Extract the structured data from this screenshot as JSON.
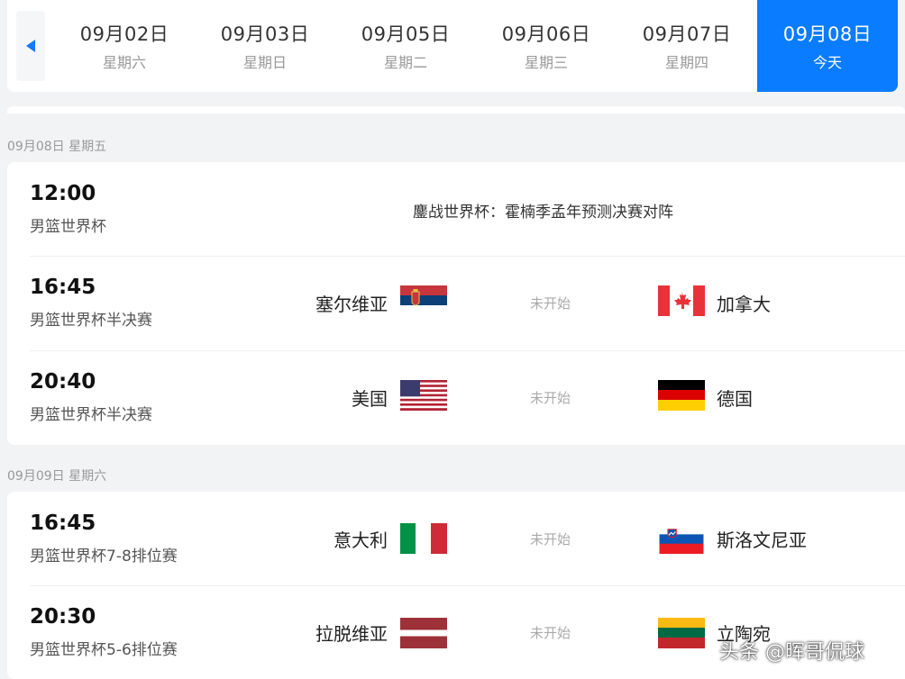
{
  "date_nav": {
    "days": [
      {
        "date": "09月02日",
        "weekday": "星期六"
      },
      {
        "date": "09月03日",
        "weekday": "星期日"
      },
      {
        "date": "09月05日",
        "weekday": "星期二"
      },
      {
        "date": "09月06日",
        "weekday": "星期三"
      },
      {
        "date": "09月07日",
        "weekday": "星期四"
      },
      {
        "date": "09月08日",
        "weekday": "今天"
      }
    ],
    "accent_color": "#0a7cff"
  },
  "sections": [
    {
      "label": "09月08日 星期五",
      "matches": [
        {
          "time": "12:00",
          "competition": "男篮世界杯",
          "special_text": "鏖战世界杯：霍楠季孟年预测决赛对阵"
        },
        {
          "time": "16:45",
          "competition": "男篮世界杯半决赛",
          "home": "塞尔维亚",
          "home_flag": "serbia-flag-icon",
          "status": "未开始",
          "away": "加拿大",
          "away_flag": "canada-flag-icon"
        },
        {
          "time": "20:40",
          "competition": "男篮世界杯半决赛",
          "home": "美国",
          "home_flag": "usa-flag-icon",
          "status": "未开始",
          "away": "德国",
          "away_flag": "germany-flag-icon"
        }
      ]
    },
    {
      "label": "09月09日 星期六",
      "matches": [
        {
          "time": "16:45",
          "competition": "男篮世界杯7-8排位赛",
          "home": "意大利",
          "home_flag": "italy-flag-icon",
          "status": "未开始",
          "away": "斯洛文尼亚",
          "away_flag": "slovenia-flag-icon"
        },
        {
          "time": "20:30",
          "competition": "男篮世界杯5-6排位赛",
          "home": "拉脱维亚",
          "home_flag": "latvia-flag-icon",
          "status": "未开始",
          "away": "立陶宛",
          "away_flag": "lithuania-flag-icon"
        }
      ]
    }
  ],
  "watermark": "头条 @晖哥侃球"
}
